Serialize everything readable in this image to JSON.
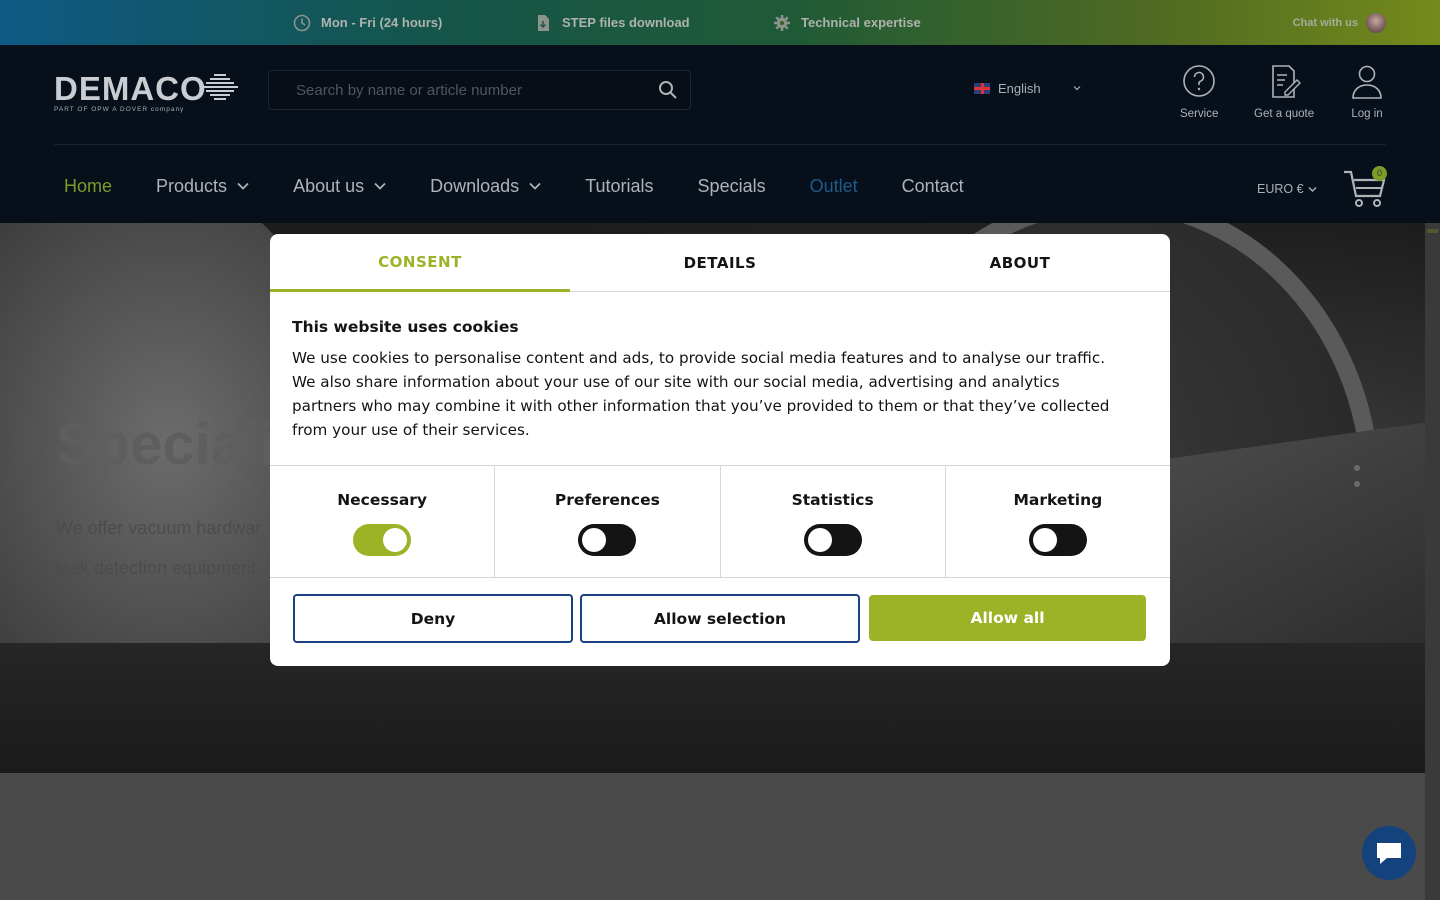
{
  "topbar": {
    "hours": "Mon - Fri (24 hours)",
    "step": "STEP files download",
    "expertise": "Technical expertise",
    "chat": "Chat with us"
  },
  "brand": {
    "name": "DEMACO",
    "tagline": "PART OF OPW   A DOVER company"
  },
  "search": {
    "placeholder": "Search by name or article number"
  },
  "language": {
    "selected": "English"
  },
  "header_actions": {
    "service": "Service",
    "quote": "Get a quote",
    "login": "Log in"
  },
  "nav": {
    "home": "Home",
    "products": "Products",
    "about": "About us",
    "downloads": "Downloads",
    "tutorials": "Tutorials",
    "specials": "Specials",
    "outlet": "Outlet",
    "contact": "Contact"
  },
  "currency": {
    "selected": "EURO €"
  },
  "cart": {
    "count": "0"
  },
  "hero": {
    "title": "Specialis",
    "subtitle": "We offer vacuum hardwar\nleak detection equipment"
  },
  "cookie": {
    "tabs": {
      "consent": "CONSENT",
      "details": "DETAILS",
      "about": "ABOUT"
    },
    "title": "This website uses cookies",
    "text": "We use cookies to personalise content and ads, to provide social media features and to analyse our traffic. We also share information about your use of our site with our social media, advertising and analytics partners who may combine it with other information that you’ve provided to them or that they’ve collected from your use of their services.",
    "categories": {
      "necessary": {
        "label": "Necessary",
        "enabled": true
      },
      "preferences": {
        "label": "Preferences",
        "enabled": false
      },
      "statistics": {
        "label": "Statistics",
        "enabled": false
      },
      "marketing": {
        "label": "Marketing",
        "enabled": false
      }
    },
    "buttons": {
      "deny": "Deny",
      "allow_selection": "Allow selection",
      "allow_all": "Allow all"
    }
  },
  "colors": {
    "accent": "#9cb227",
    "button_border": "#1b3f83",
    "header_bg": "#07101a",
    "chat_bubble": "#14427d"
  },
  "icons": [
    "clock-icon",
    "file-icon",
    "gear-icon",
    "search-icon",
    "help-circle-icon",
    "quote-icon",
    "user-icon",
    "chevron-down-icon",
    "cart-icon",
    "chat-icon"
  ]
}
